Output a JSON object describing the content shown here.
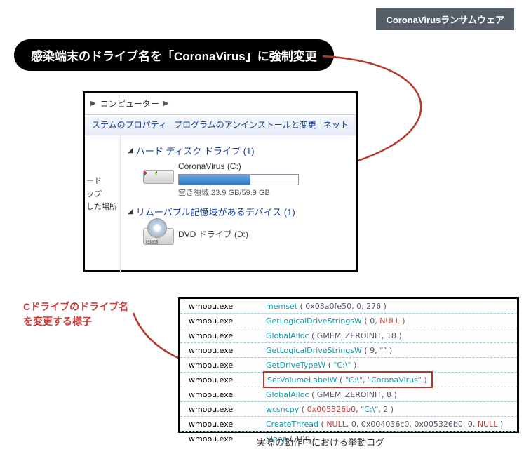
{
  "topbar": "CoronaVirusランサムウェア",
  "headline": "感染端末のドライブ名を「CoronaVirus」に強制変更",
  "explorer": {
    "breadcrumb_label": "コンピューター",
    "breadcrumb_arrows": {
      "left": "▶",
      "right": "▶"
    },
    "menu": {
      "prop": "ステムのプロパティ",
      "uninstall": "プログラムのアンインストールと変更",
      "net": "ネット"
    },
    "side": {
      "line1": "ード",
      "line2": "ップ",
      "line3": "した場所"
    },
    "hdd_section": "ハード ディスク ドライブ (1)",
    "drive_c": {
      "name": "CoronaVirus (C:)",
      "free": "空き領域 23.9 GB/59.9 GB"
    },
    "rem_section": "リムーバブル記憶域があるデバイス (1)",
    "dvd": {
      "name": "DVD ドライブ (D:)",
      "badge": "DVD"
    }
  },
  "anno": {
    "line1": "Cドライブのドライブ名",
    "line2": "を変更する様子"
  },
  "caption": "実際の動作中における挙動ログ",
  "log": {
    "proc": "wmoou.exe",
    "rows": {
      "r0": {
        "fn": "memset",
        "text": " ( 0x03a0fe50, 0, 276 )"
      },
      "r1": {
        "fn": "GetLogicalDriveStringsW",
        "prefix": " ( 0, ",
        "null": "NULL",
        "suffix": " )"
      },
      "r2": {
        "fn": "GlobalAlloc",
        "text": " ( GMEM_ZEROINIT, 18 )"
      },
      "r3": {
        "fn": "GetLogicalDriveStringsW",
        "text": " ( 9, \"\" )"
      },
      "r4": {
        "fn": "GetDriveTypeW",
        "prefix": " ( ",
        "str": "\"C:\\\"",
        "suffix": " )"
      },
      "r5": {
        "fn": "SetVolumeLabelW",
        "prefix": " ( ",
        "s1": "\"C:\\\"",
        "comma": ", ",
        "s2": "\"CoronaVirus\"",
        "suffix": " )"
      },
      "r6": {
        "fn": "GlobalAlloc",
        "text": " ( GMEM_ZEROINIT, 8 )"
      },
      "r7": {
        "fn": "wcsncpy",
        "prefix": " ( ",
        "num": "0x005326b0",
        "mid": ", ",
        "str": "\"C:\\\"",
        "suffix": ", 2 )"
      },
      "r8": {
        "fn": "CreateThread",
        "p1": " ( ",
        "k1": "NULL",
        "c1": ", 0, ",
        "a1": "0x004036c0",
        "c2": ", ",
        "a2": "0x005326b0",
        "c3": ", 0, ",
        "k2": "NULL",
        "p2": " )"
      },
      "r9": {
        "fn": "Sleep",
        "text": " ( 100 )"
      }
    }
  }
}
